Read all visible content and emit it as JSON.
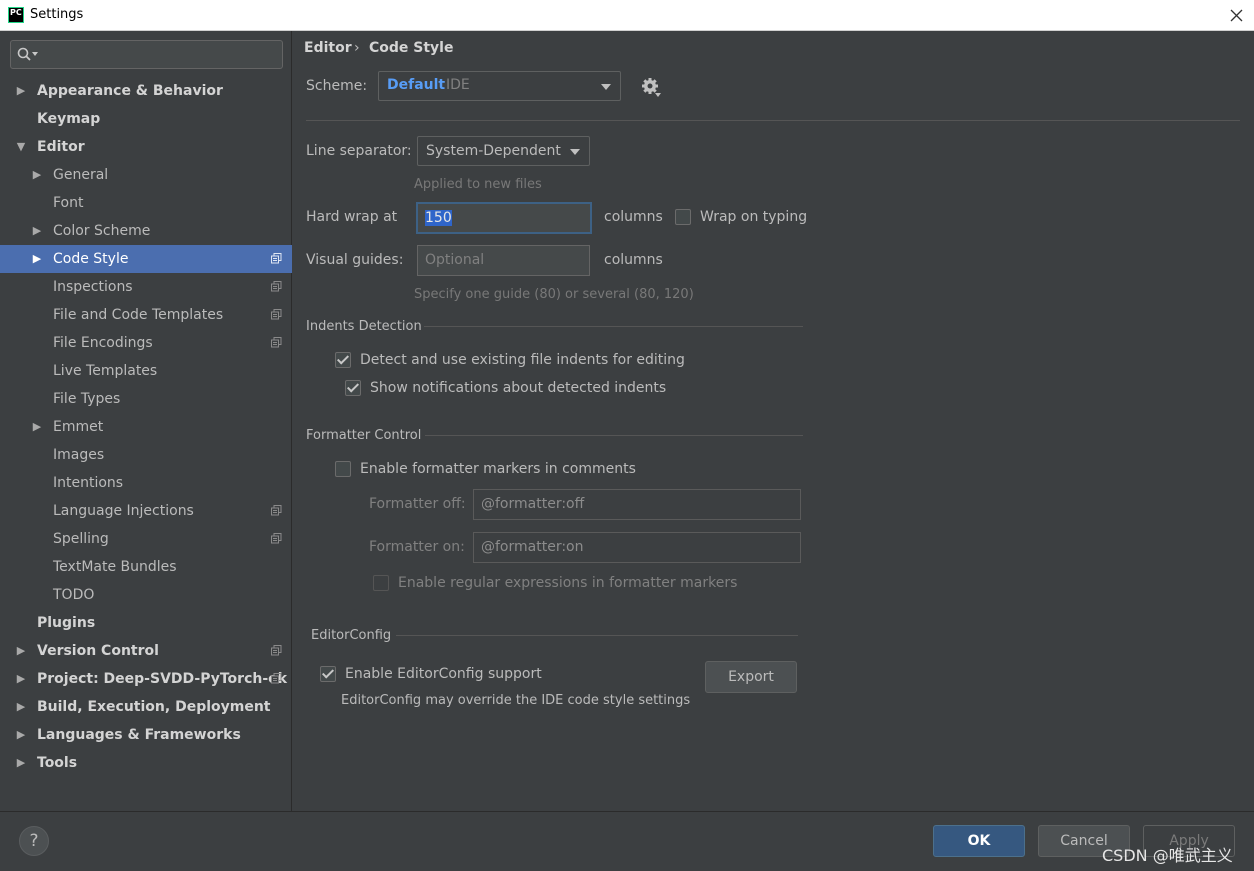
{
  "window": {
    "title": "Settings",
    "app_icon_text": "PC"
  },
  "search": {
    "placeholder": "",
    "value": ""
  },
  "sidebar": {
    "items": [
      {
        "label": "Appearance & Behavior",
        "level": 0,
        "arrow": "right"
      },
      {
        "label": "Keymap",
        "level": 0,
        "arrow": "none"
      },
      {
        "label": "Editor",
        "level": 0,
        "arrow": "down"
      },
      {
        "label": "General",
        "level": 1,
        "arrow": "right"
      },
      {
        "label": "Font",
        "level": 1,
        "arrow": "none"
      },
      {
        "label": "Color Scheme",
        "level": 1,
        "arrow": "right"
      },
      {
        "label": "Code Style",
        "level": 1,
        "arrow": "right",
        "selected": true,
        "copy_icon": true
      },
      {
        "label": "Inspections",
        "level": 1,
        "arrow": "none",
        "copy_icon": true
      },
      {
        "label": "File and Code Templates",
        "level": 1,
        "arrow": "none",
        "copy_icon": true
      },
      {
        "label": "File Encodings",
        "level": 1,
        "arrow": "none",
        "copy_icon": true
      },
      {
        "label": "Live Templates",
        "level": 1,
        "arrow": "none"
      },
      {
        "label": "File Types",
        "level": 1,
        "arrow": "none"
      },
      {
        "label": "Emmet",
        "level": 1,
        "arrow": "right"
      },
      {
        "label": "Images",
        "level": 1,
        "arrow": "none"
      },
      {
        "label": "Intentions",
        "level": 1,
        "arrow": "none"
      },
      {
        "label": "Language Injections",
        "level": 1,
        "arrow": "none",
        "copy_icon": true
      },
      {
        "label": "Spelling",
        "level": 1,
        "arrow": "none",
        "copy_icon": true
      },
      {
        "label": "TextMate Bundles",
        "level": 1,
        "arrow": "none"
      },
      {
        "label": "TODO",
        "level": 1,
        "arrow": "none"
      },
      {
        "label": "Plugins",
        "level": 0,
        "arrow": "none"
      },
      {
        "label": "Version Control",
        "level": 0,
        "arrow": "right",
        "copy_icon": true
      },
      {
        "label": "Project: Deep-SVDD-PyTorch-ok",
        "level": 0,
        "arrow": "right",
        "copy_icon": true
      },
      {
        "label": "Build, Execution, Deployment",
        "level": 0,
        "arrow": "right"
      },
      {
        "label": "Languages & Frameworks",
        "level": 0,
        "arrow": "right"
      },
      {
        "label": "Tools",
        "level": 0,
        "arrow": "right"
      }
    ]
  },
  "breadcrumb": {
    "parent": "Editor",
    "separator": "›",
    "current": "Code Style"
  },
  "scheme": {
    "label": "Scheme:",
    "name": "Default",
    "scope": "IDE"
  },
  "line_separator": {
    "label": "Line separator:",
    "value": "System-Dependent",
    "hint": "Applied to new files"
  },
  "hard_wrap": {
    "label": "Hard wrap at",
    "value": "150",
    "unit": "columns",
    "wrap_on_typing_label": "Wrap on typing",
    "wrap_on_typing_checked": false
  },
  "visual_guides": {
    "label": "Visual guides:",
    "placeholder": "Optional",
    "unit": "columns",
    "hint": "Specify one guide (80) or several (80, 120)"
  },
  "indents_detection": {
    "title": "Indents Detection",
    "detect_label": "Detect and use existing file indents for editing",
    "detect_checked": true,
    "notify_label": "Show notifications about detected indents",
    "notify_checked": true
  },
  "formatter_control": {
    "title": "Formatter Control",
    "enable_label": "Enable formatter markers in comments",
    "enable_checked": false,
    "off_label": "Formatter off:",
    "off_value": "@formatter:off",
    "on_label": "Formatter on:",
    "on_value": "@formatter:on",
    "regex_label": "Enable regular expressions in formatter markers",
    "regex_checked": false
  },
  "editor_config": {
    "title": "EditorConfig",
    "enable_label": "Enable EditorConfig support",
    "enable_checked": true,
    "export_label": "Export",
    "note": "EditorConfig may override the IDE code style settings"
  },
  "footer": {
    "help_label": "?",
    "ok_label": "OK",
    "cancel_label": "Cancel",
    "apply_label": "Apply"
  },
  "watermark": "CSDN @唯武主义",
  "colors": {
    "accent": "#4b6eaf",
    "scheme_name": "#589df6",
    "background": "#3c3f41",
    "ok_button": "#365880"
  }
}
